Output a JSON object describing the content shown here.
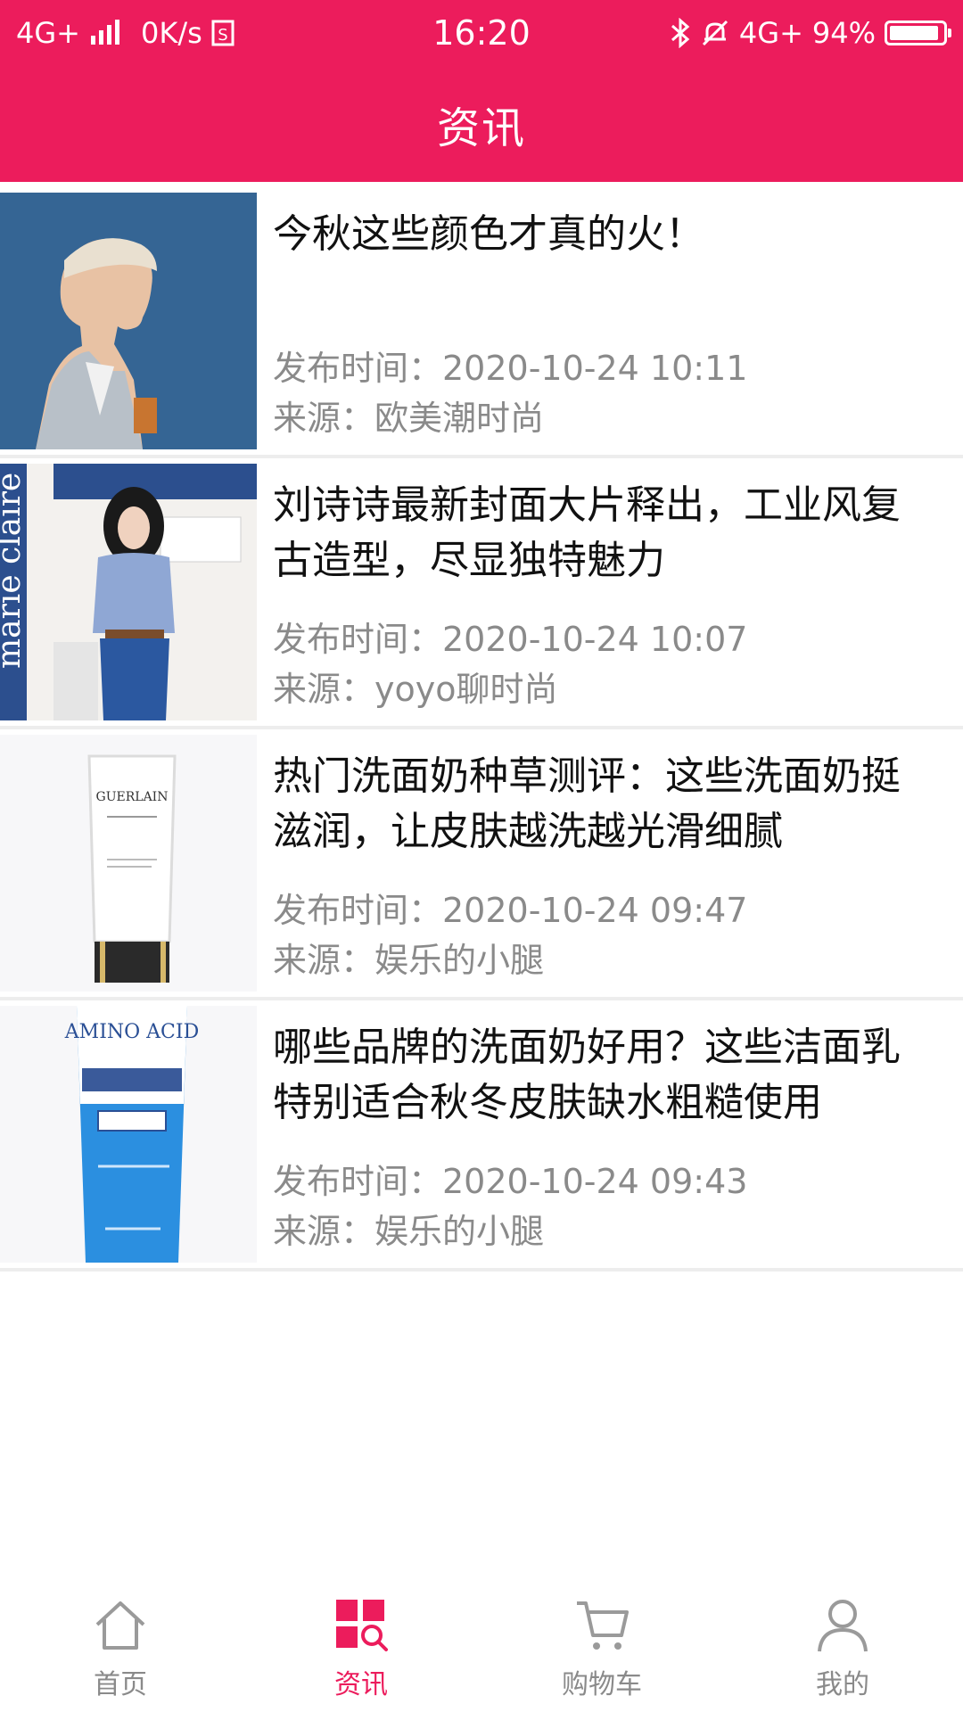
{
  "status_bar": {
    "network": "4G+",
    "speed": "0K/s",
    "time": "16:20",
    "network_right": "4G+",
    "battery_percent": "94%",
    "battery_level": 0.94
  },
  "header": {
    "title": "资讯"
  },
  "news": [
    {
      "title": "今秋这些颜色才真的火！",
      "time": "发布时间：2020-10-24 10:11",
      "source": "来源：欧美潮时尚"
    },
    {
      "title": "刘诗诗最新封面大片释出，工业风复古造型，尽显独特魅力",
      "time": "发布时间：2020-10-24 10:07",
      "source": "来源：yoyo聊时尚",
      "thumb_text": "marie claire"
    },
    {
      "title": "热门洗面奶种草测评：这些洗面奶挺滋润，让皮肤越洗越光滑细腻",
      "time": "发布时间：2020-10-24 09:47",
      "source": "来源：娱乐的小腿",
      "thumb_text": "GUERLAIN"
    },
    {
      "title": "哪些品牌的洗面奶好用？这些洁面乳特别适合秋冬皮肤缺水粗糙使用",
      "time": "发布时间：2020-10-24 09:43",
      "source": "来源：娱乐的小腿",
      "thumb_text": "AMINO ACID"
    }
  ],
  "nav": [
    {
      "label": "首页",
      "icon": "home-icon"
    },
    {
      "label": "资讯",
      "icon": "news-grid-icon",
      "active": true
    },
    {
      "label": "购物车",
      "icon": "cart-icon"
    },
    {
      "label": "我的",
      "icon": "user-icon"
    }
  ],
  "colors": {
    "brand": "#ec1c5c",
    "inactive": "#8a8a8a",
    "meta_text": "#8a8a8a"
  }
}
